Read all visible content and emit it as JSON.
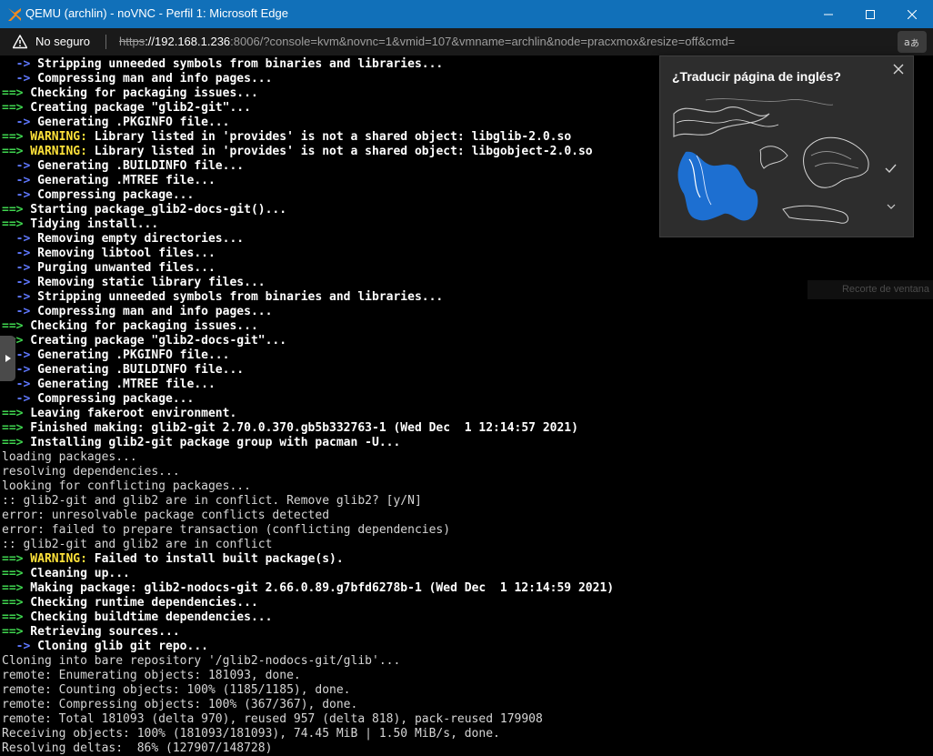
{
  "window": {
    "title": "QEMU (archlin) - noVNC - Perfil 1: Microsoft Edge",
    "buttons": [
      "minimize-icon",
      "maximize-icon",
      "close-icon"
    ]
  },
  "addressbar": {
    "security_label": "No seguro",
    "url_scheme": "https",
    "url_host": "://192.168.1.236",
    "url_rest": ":8006/?console=kvm&novnc=1&vmid=107&vmname=archlin&node=pracxmox&resize=off&cmd=",
    "translate_icon": "translate-icon"
  },
  "translate_popup": {
    "title": "¿Traducir página de inglés?"
  },
  "snip_label": "Recorte de ventana",
  "colors": {
    "titlebar": "#1170b9",
    "console_bg": "#000000",
    "arrow_blue": "#5f78ff",
    "arrow_green": "#3fd64f",
    "warning": "#ffe23a"
  },
  "console_lines": [
    {
      "prefix": "  ->",
      "pc": "b",
      "text": " Stripping unneeded symbols from binaries and libraries..."
    },
    {
      "prefix": "  ->",
      "pc": "b",
      "text": " Compressing man and info pages..."
    },
    {
      "prefix": "==>",
      "pc": "g",
      "text": " Checking for packaging issues..."
    },
    {
      "prefix": "==>",
      "pc": "g",
      "text": " Creating package \"glib2-git\"..."
    },
    {
      "prefix": "  ->",
      "pc": "b",
      "text": " Generating .PKGINFO file..."
    },
    {
      "prefix": "==>",
      "pc": "g",
      "warn": " WARNING:",
      "text": " Library listed in 'provides' is not a shared object: libglib-2.0.so"
    },
    {
      "prefix": "==>",
      "pc": "g",
      "warn": " WARNING:",
      "text": " Library listed in 'provides' is not a shared object: libgobject-2.0.so"
    },
    {
      "prefix": "  ->",
      "pc": "b",
      "text": " Generating .BUILDINFO file..."
    },
    {
      "prefix": "  ->",
      "pc": "b",
      "text": " Generating .MTREE file..."
    },
    {
      "prefix": "  ->",
      "pc": "b",
      "text": " Compressing package..."
    },
    {
      "prefix": "==>",
      "pc": "g",
      "text": " Starting package_glib2-docs-git()..."
    },
    {
      "prefix": "==>",
      "pc": "g",
      "text": " Tidying install..."
    },
    {
      "prefix": "  ->",
      "pc": "b",
      "text": " Removing empty directories..."
    },
    {
      "prefix": "  ->",
      "pc": "b",
      "text": " Removing libtool files..."
    },
    {
      "prefix": "  ->",
      "pc": "b",
      "text": " Purging unwanted files..."
    },
    {
      "prefix": "  ->",
      "pc": "b",
      "text": " Removing static library files..."
    },
    {
      "prefix": "  ->",
      "pc": "b",
      "text": " Stripping unneeded symbols from binaries and libraries..."
    },
    {
      "prefix": "  ->",
      "pc": "b",
      "text": " Compressing man and info pages..."
    },
    {
      "prefix": "==>",
      "pc": "g",
      "text": " Checking for packaging issues..."
    },
    {
      "prefix": "==>",
      "pc": "g",
      "text": " Creating package \"glib2-docs-git\"..."
    },
    {
      "prefix": "  ->",
      "pc": "b",
      "text": " Generating .PKGINFO file..."
    },
    {
      "prefix": "  ->",
      "pc": "b",
      "text": " Generating .BUILDINFO file..."
    },
    {
      "prefix": "  ->",
      "pc": "b",
      "text": " Generating .MTREE file..."
    },
    {
      "prefix": "  ->",
      "pc": "b",
      "text": " Compressing package..."
    },
    {
      "prefix": "==>",
      "pc": "g",
      "text": " Leaving fakeroot environment."
    },
    {
      "prefix": "==>",
      "pc": "g",
      "text": " Finished making: glib2-git 2.70.0.370.gb5b332763-1 (Wed Dec  1 12:14:57 2021)"
    },
    {
      "prefix": "==>",
      "pc": "g",
      "text": " Installing glib2-git package group with pacman -U..."
    },
    {
      "prefix": "",
      "pc": "",
      "text": "loading packages..."
    },
    {
      "prefix": "",
      "pc": "",
      "text": "resolving dependencies..."
    },
    {
      "prefix": "",
      "pc": "",
      "text": "looking for conflicting packages..."
    },
    {
      "prefix": "",
      "pc": "",
      "text": ":: glib2-git and glib2 are in conflict. Remove glib2? [y/N]"
    },
    {
      "prefix": "",
      "pc": "",
      "text": "error: unresolvable package conflicts detected"
    },
    {
      "prefix": "",
      "pc": "",
      "text": "error: failed to prepare transaction (conflicting dependencies)"
    },
    {
      "prefix": "",
      "pc": "",
      "text": ":: glib2-git and glib2 are in conflict"
    },
    {
      "prefix": "==>",
      "pc": "g",
      "warn": " WARNING:",
      "text": " Failed to install built package(s)."
    },
    {
      "prefix": "==>",
      "pc": "g",
      "text": " Cleaning up..."
    },
    {
      "prefix": "==>",
      "pc": "g",
      "text": " Making package: glib2-nodocs-git 2.66.0.89.g7bfd6278b-1 (Wed Dec  1 12:14:59 2021)"
    },
    {
      "prefix": "==>",
      "pc": "g",
      "text": " Checking runtime dependencies..."
    },
    {
      "prefix": "==>",
      "pc": "g",
      "text": " Checking buildtime dependencies..."
    },
    {
      "prefix": "==>",
      "pc": "g",
      "text": " Retrieving sources..."
    },
    {
      "prefix": "  ->",
      "pc": "b",
      "text": " Cloning glib git repo..."
    },
    {
      "prefix": "",
      "pc": "",
      "text": "Cloning into bare repository '/glib2-nodocs-git/glib'..."
    },
    {
      "prefix": "",
      "pc": "",
      "text": "remote: Enumerating objects: 181093, done."
    },
    {
      "prefix": "",
      "pc": "",
      "text": "remote: Counting objects: 100% (1185/1185), done."
    },
    {
      "prefix": "",
      "pc": "",
      "text": "remote: Compressing objects: 100% (367/367), done."
    },
    {
      "prefix": "",
      "pc": "",
      "text": "remote: Total 181093 (delta 970), reused 957 (delta 818), pack-reused 179908"
    },
    {
      "prefix": "",
      "pc": "",
      "text": "Receiving objects: 100% (181093/181093), 74.45 MiB | 1.50 MiB/s, done."
    },
    {
      "prefix": "",
      "pc": "",
      "text": "Resolving deltas:  86% (127907/148728)"
    }
  ]
}
